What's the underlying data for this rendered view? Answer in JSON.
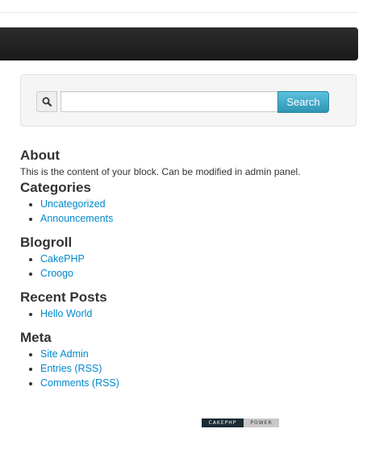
{
  "search": {
    "icon": "search-icon",
    "value": "",
    "placeholder": "",
    "button_label": "Search",
    "button_color": "#49afcd"
  },
  "blocks": {
    "about": {
      "title": "About",
      "body": "This is the content of your block. Can be modified in admin panel."
    },
    "categories": {
      "title": "Categories",
      "items": [
        "Uncategorized",
        "Announcements"
      ]
    },
    "blogroll": {
      "title": "Blogroll",
      "items": [
        "CakePHP",
        "Croogo"
      ]
    },
    "recent_posts": {
      "title": "Recent Posts",
      "items": [
        "Hello World"
      ]
    },
    "meta": {
      "title": "Meta",
      "items": [
        "Site Admin",
        "Entries (RSS)",
        "Comments (RSS)"
      ]
    }
  },
  "footer": {
    "badge_left": "CAKEPHP",
    "badge_right": "POWER"
  },
  "colors": {
    "link": "#0088cc",
    "navbar": "#222222",
    "text": "#333333"
  }
}
